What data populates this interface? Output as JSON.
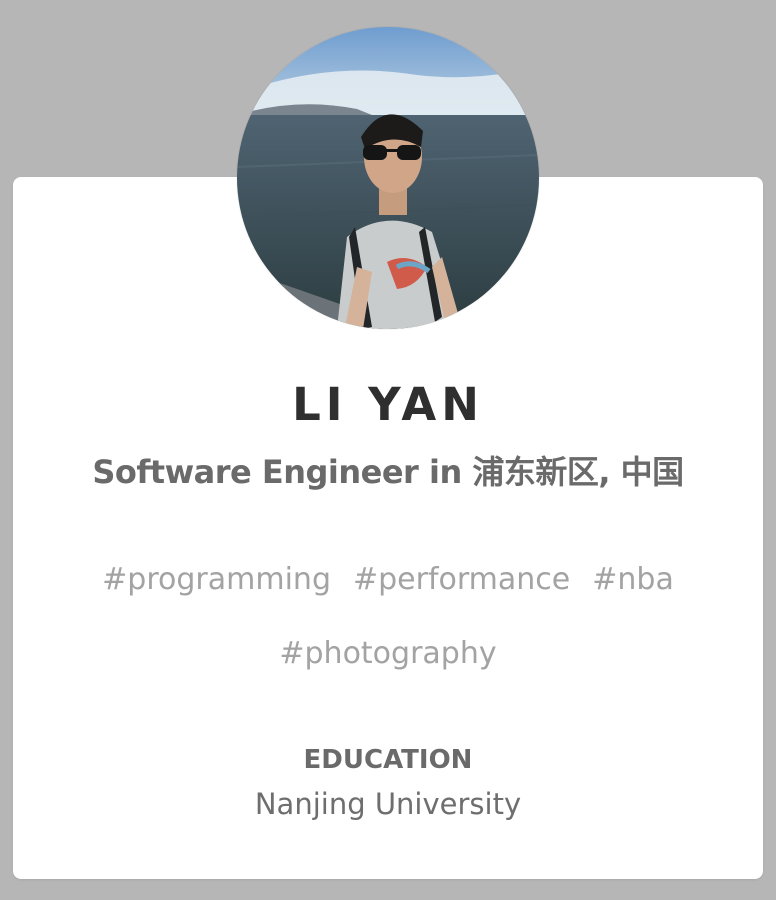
{
  "profile": {
    "name": "LI YAN",
    "headline": "Software Engineer in 浦东新区, 中国",
    "tags_row1": [
      "#programming",
      "#performance",
      "#nba"
    ],
    "tags_row2": [
      "#photography"
    ],
    "education_label": "EDUCATION",
    "education_value": "Nanjing University"
  },
  "colors": {
    "page_background": "#b6b6b6",
    "card_background": "#ffffff",
    "name_text": "#2f2f2f",
    "headline_text": "#6a6a6a",
    "tag_text": "#a3a3a3"
  },
  "icons": {
    "avatar": "profile-photo"
  }
}
